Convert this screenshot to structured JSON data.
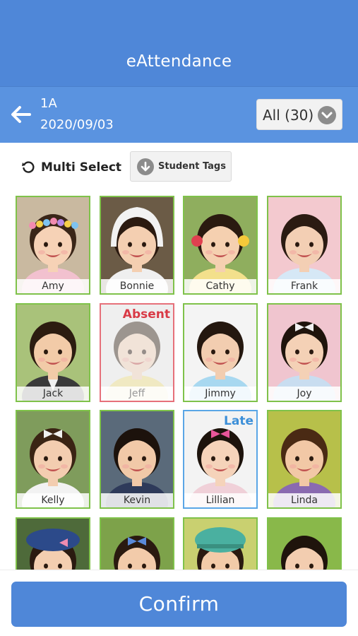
{
  "header": {
    "title": "eAttendance"
  },
  "class_info": {
    "class_name": "1A",
    "date": "2020/09/03"
  },
  "filter": {
    "label": "All (30)"
  },
  "toolbar": {
    "multi_select_label": "Multi Select",
    "student_tags_label": "Student Tags"
  },
  "students": [
    {
      "name": "Amy",
      "status": "",
      "bg": "#c9b9a0",
      "skin": "#f6d2b6",
      "hair": "#3a2618",
      "shirt": "#f2c1cf",
      "accessory": "flower-crown"
    },
    {
      "name": "Bonnie",
      "status": "",
      "bg": "#6b5b46",
      "skin": "#f4cfb1",
      "hair": "#2b1a10",
      "shirt": "#efefef",
      "accessory": "hood"
    },
    {
      "name": "Cathy",
      "status": "",
      "bg": "#8fae5e",
      "skin": "#f5d0b0",
      "hair": "#2a1a10",
      "shirt": "#f3e08c",
      "accessory": "ribbons"
    },
    {
      "name": "Frank",
      "status": "",
      "bg": "#f3c9cf",
      "skin": "#f3cfb4",
      "hair": "#2b1b12",
      "shirt": "#d6e8f6",
      "accessory": ""
    },
    {
      "name": "Jack",
      "status": "",
      "bg": "#a9c27a",
      "skin": "#f2cba8",
      "hair": "#2c1c10",
      "shirt": "#3a3a3a",
      "accessory": "suit"
    },
    {
      "name": "Jeff",
      "status": "Absent",
      "bg": "#f1f1f1",
      "skin": "#f6d6be",
      "hair": "#3a2a1e",
      "shirt": "#f3e38e",
      "accessory": ""
    },
    {
      "name": "Jimmy",
      "status": "",
      "bg": "#f4f4f4",
      "skin": "#f2cdb0",
      "hair": "#24170f",
      "shirt": "#a8d8f0",
      "accessory": ""
    },
    {
      "name": "Joy",
      "status": "",
      "bg": "#f0c5cf",
      "skin": "#f4d1b6",
      "hair": "#1f140c",
      "shirt": "#c9ddf0",
      "accessory": "bow"
    },
    {
      "name": "Kelly",
      "status": "",
      "bg": "#7f9c5c",
      "skin": "#f3cdb0",
      "hair": "#3a2414",
      "shirt": "#f2f2f2",
      "accessory": "scrunchie"
    },
    {
      "name": "Kevin",
      "status": "",
      "bg": "#5a6a7a",
      "skin": "#f1c9a8",
      "hair": "#1c120c",
      "shirt": "#2e3a5a",
      "accessory": ""
    },
    {
      "name": "Lillian",
      "status": "Late",
      "bg": "#f3f3f3",
      "skin": "#f5d3ba",
      "hair": "#1d130c",
      "shirt": "#f0d0d8",
      "accessory": "headband"
    },
    {
      "name": "Linda",
      "status": "",
      "bg": "#b7c04a",
      "skin": "#f2c8a6",
      "hair": "#4a2a14",
      "shirt": "#8a6ab0",
      "accessory": ""
    },
    {
      "name": "",
      "status": "",
      "bg": "#4e6a3a",
      "skin": "#f3ceb0",
      "hair": "#2a1a10",
      "shirt": "#3b4f8a",
      "accessory": "beret"
    },
    {
      "name": "",
      "status": "",
      "bg": "#7da24a",
      "skin": "#f2cbaa",
      "hair": "#2a1a10",
      "shirt": "#f0f0f0",
      "accessory": "clip"
    },
    {
      "name": "",
      "status": "",
      "bg": "#c9d070",
      "skin": "#f2cba8",
      "hair": "#2a1a10",
      "shirt": "#f0f0f0",
      "accessory": "cap"
    },
    {
      "name": "",
      "status": "",
      "bg": "#89b84a",
      "skin": "#f3cdb0",
      "hair": "#1f140c",
      "shirt": "#f0f0f0",
      "accessory": ""
    }
  ],
  "confirm_label": "Confirm"
}
